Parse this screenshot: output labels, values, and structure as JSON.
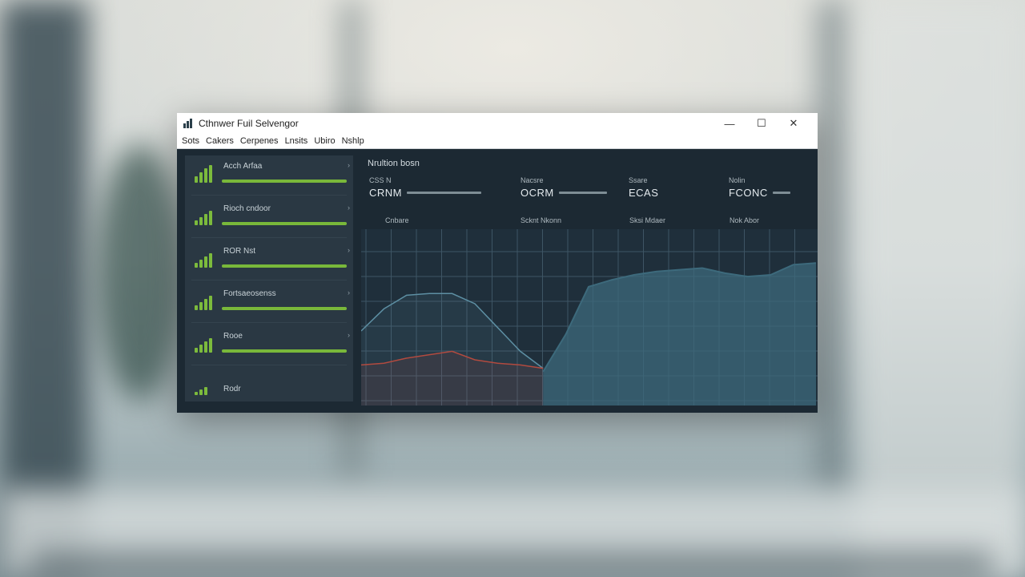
{
  "window": {
    "title": "Cthnwer Fuil Selvengor",
    "controls": [
      "—",
      "☐",
      "✕"
    ]
  },
  "menu": [
    "Sots",
    "Cakers",
    "Cerpenes",
    "Lnsits",
    "Ubiro",
    "Nshlp"
  ],
  "sidebar": {
    "items": [
      {
        "label": "Acch Arfaa",
        "chevron": "›",
        "level": 1.0,
        "icon": "signal-bars-icon"
      },
      {
        "label": "Rioch cndoor",
        "chevron": "›",
        "level": 1.0,
        "icon": "signal-bars-icon"
      },
      {
        "label": "ROR Nst",
        "chevron": "›",
        "level": 1.0,
        "icon": "signal-bars-icon"
      },
      {
        "label": "Fortsaeosenss",
        "chevron": "›",
        "level": 1.0,
        "icon": "signal-bars-icon"
      },
      {
        "label": "Rooe",
        "chevron": "›",
        "level": 1.0,
        "icon": "signal-bars-icon"
      },
      {
        "label": "Rodr",
        "chevron": "",
        "level": 0,
        "icon": "signal-bars-icon"
      }
    ]
  },
  "main": {
    "title": "Nrultion bosn",
    "metrics": [
      {
        "label": "CSS N",
        "value": "CRNM"
      },
      {
        "label": "Nacsre",
        "value": "OCRM"
      },
      {
        "label": "Ssare",
        "value": "ECAS"
      },
      {
        "label": "Nolin",
        "value": "FCONC"
      }
    ],
    "column_headers": [
      "Cnbare",
      "Scknt Nkonn",
      "Sksi Mdaer",
      "Nok Abor"
    ]
  },
  "chart_data": {
    "type": "area",
    "title": "",
    "xlabel": "",
    "ylabel": "",
    "grid": true,
    "x": [
      0,
      1,
      2,
      3,
      4,
      5,
      6,
      7,
      8,
      9,
      10,
      11,
      12,
      13,
      14,
      15,
      16,
      17,
      18,
      19,
      20
    ],
    "series": [
      {
        "type": "line",
        "color": "#5d8fa3",
        "values": [
          42,
          55,
          63,
          64,
          64,
          58,
          44,
          30,
          20,
          null,
          null,
          null,
          null,
          null,
          null,
          null,
          null,
          null,
          null,
          null,
          null
        ]
      },
      {
        "type": "area",
        "color": "#3d6a7c",
        "values": [
          null,
          null,
          null,
          null,
          null,
          null,
          null,
          null,
          18,
          40,
          68,
          72,
          75,
          77,
          78,
          79,
          76,
          74,
          75,
          81,
          82
        ]
      },
      {
        "type": "line",
        "color": "#b24a3f",
        "values": [
          22,
          23,
          26,
          28,
          30,
          25,
          23,
          22,
          20,
          null,
          null,
          null,
          null,
          null,
          null,
          null,
          null,
          null,
          null,
          null,
          null
        ]
      }
    ],
    "ylim": [
      0,
      100
    ]
  },
  "colors": {
    "accent": "#79b83a",
    "panel": "#1c2933",
    "sidebar": "#2a3843"
  }
}
